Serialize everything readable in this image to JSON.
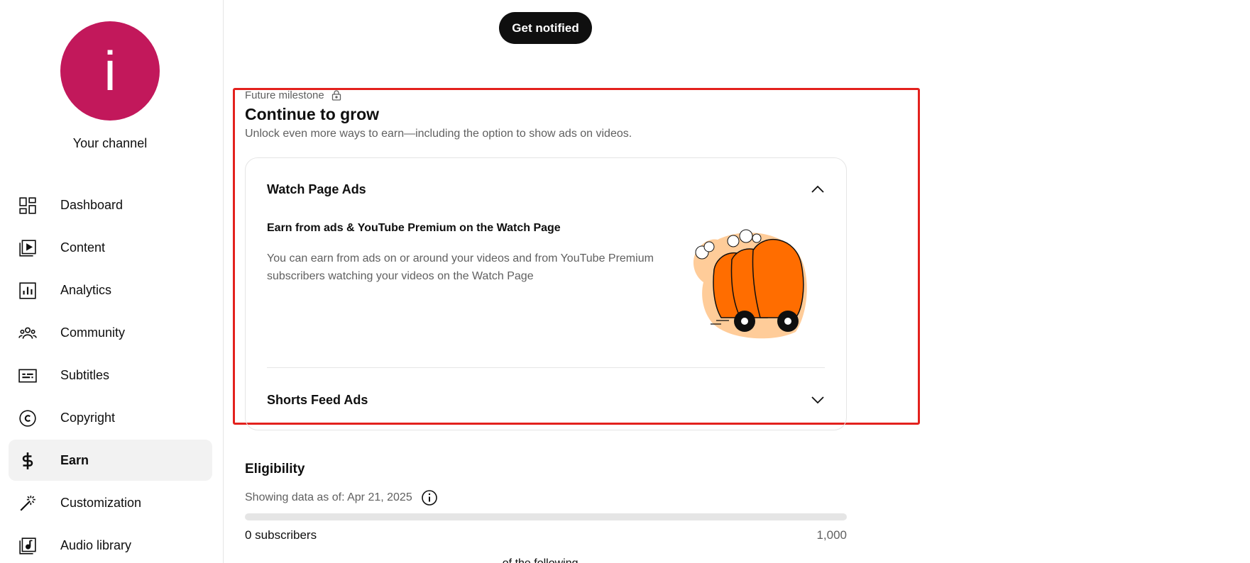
{
  "sidebar": {
    "avatar_letter": "i",
    "avatar_color": "#c2185b",
    "channel_label": "Your channel",
    "items": [
      {
        "label": "Dashboard",
        "icon": "dashboard-icon"
      },
      {
        "label": "Content",
        "icon": "content-icon"
      },
      {
        "label": "Analytics",
        "icon": "analytics-icon"
      },
      {
        "label": "Community",
        "icon": "community-icon"
      },
      {
        "label": "Subtitles",
        "icon": "subtitles-icon"
      },
      {
        "label": "Copyright",
        "icon": "copyright-icon"
      },
      {
        "label": "Earn",
        "icon": "dollar-icon",
        "active": true
      },
      {
        "label": "Customization",
        "icon": "magic-wand-icon"
      },
      {
        "label": "Audio library",
        "icon": "audio-library-icon"
      }
    ]
  },
  "header": {
    "notify_label": "Get notified"
  },
  "milestone": {
    "label": "Future milestone",
    "icon": "lock-icon",
    "title": "Continue to grow",
    "subtitle": "Unlock even more ways to earn—including the option to show ads on videos."
  },
  "accordion": {
    "watch_page": {
      "title": "Watch Page Ads",
      "expanded": true,
      "heading": "Earn from ads & YouTube Premium on the Watch Page",
      "description": "You can earn from ads on or around your videos and from YouTube Premium subscribers watching your videos on the Watch Page",
      "illustration": "orange-car-illustration"
    },
    "shorts_feed": {
      "title": "Shorts Feed Ads",
      "expanded": false
    }
  },
  "eligibility": {
    "title": "Eligibility",
    "date_label": "Showing data as of: Apr 21, 2025",
    "current": "0 subscribers",
    "goal": "1,000",
    "progress_fraction": 0,
    "cutoff_text": "... of the following"
  },
  "colors": {
    "highlight": "#e3211d",
    "accent_orange": "#ff6d00"
  }
}
